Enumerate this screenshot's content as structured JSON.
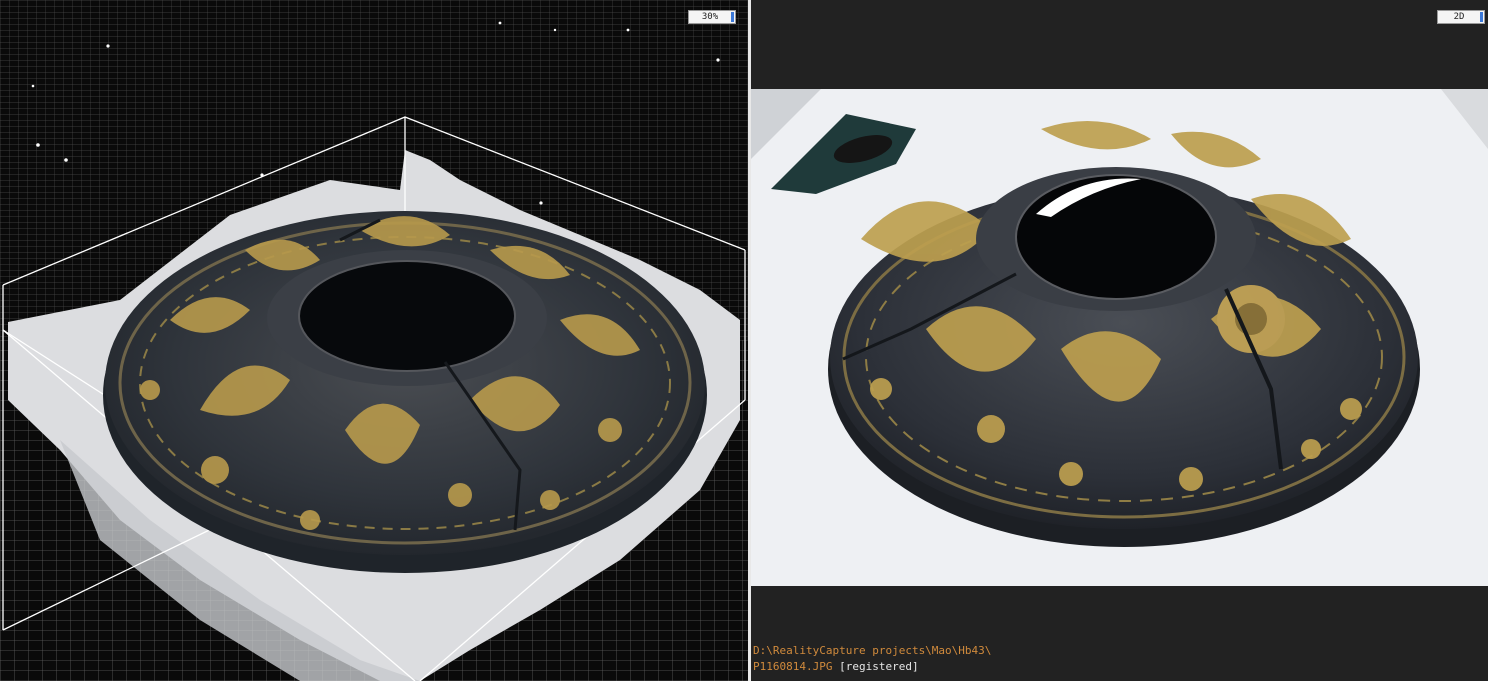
{
  "viewport_3d": {
    "badge_label": "30%",
    "colors": {
      "background": "#0a0a0a",
      "grid": "#5a5a5a",
      "bbox": "#ffffff",
      "metal_dark": "#2c333d",
      "gold": "#b99a4a"
    }
  },
  "viewport_2d": {
    "badge_label": "2D",
    "image_path": "D:\\RealityCapture projects\\Mao\\Hb43\\",
    "image_file": "P1160814.JPG",
    "image_status": "[registered]",
    "colors": {
      "background": "#222222",
      "path_text": "#d08a3c",
      "status_text": "#e6e6e6"
    }
  }
}
